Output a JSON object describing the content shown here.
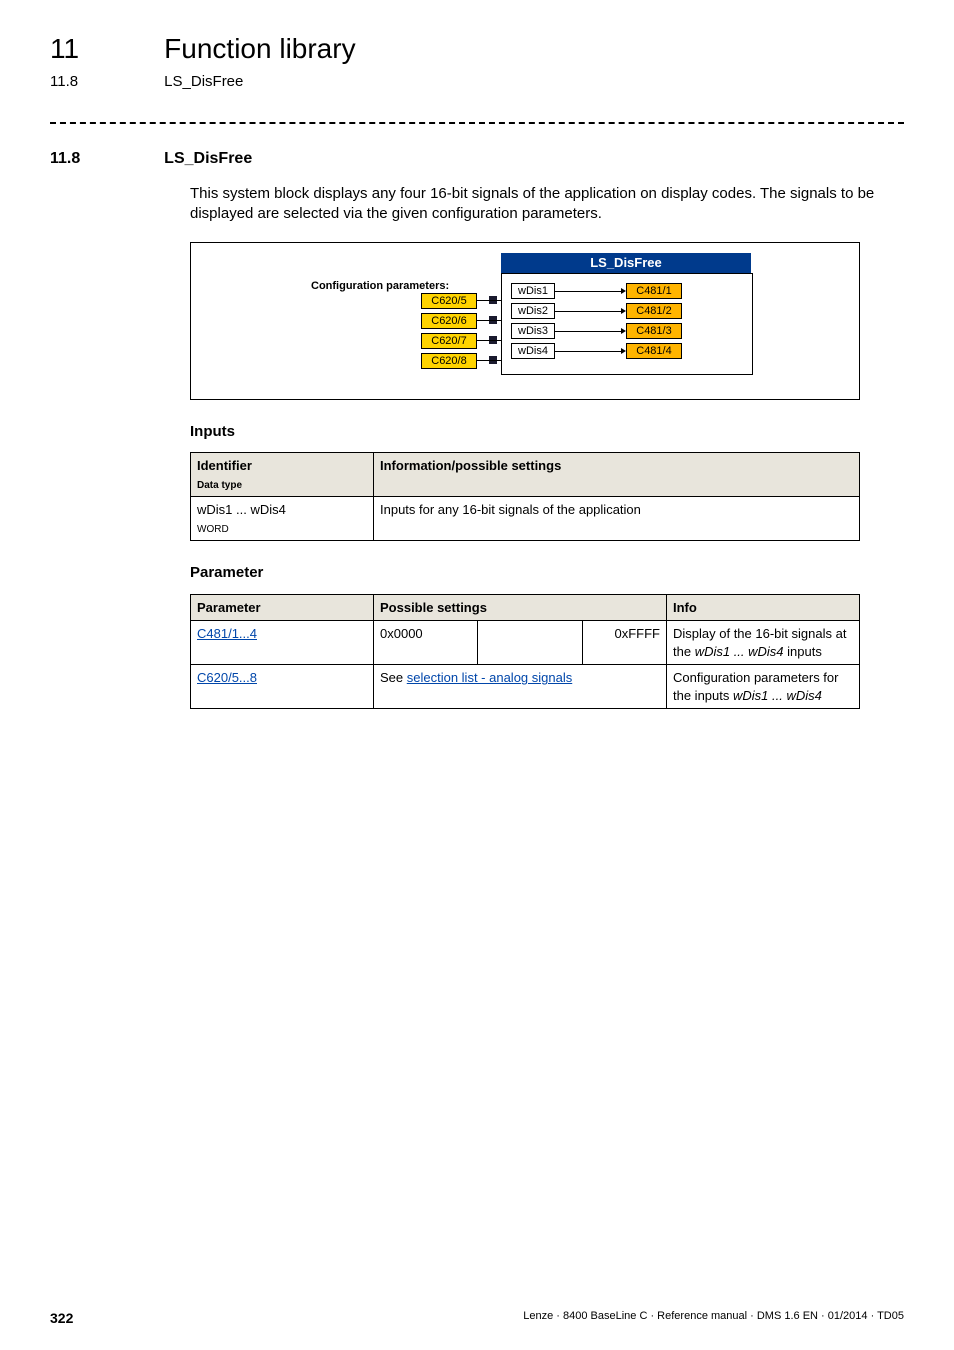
{
  "header": {
    "chapter_number": "11",
    "chapter_title": "Function library",
    "section_number": "11.8",
    "section_name": "LS_DisFree"
  },
  "section": {
    "num": "11.8",
    "title": "LS_DisFree",
    "intro": "This system block displays any four 16-bit signals of the application on display codes. The signals to be displayed are selected via the given configuration parameters."
  },
  "diagram": {
    "titlebar": "LS_DisFree",
    "conf_label": "Configuration parameters:",
    "yellow": [
      "C620/5",
      "C620/6",
      "C620/7",
      "C620/8"
    ],
    "wlabels": [
      "wDis1",
      "wDis2",
      "wDis3",
      "wDis4"
    ],
    "orange": [
      "C481/1",
      "C481/2",
      "C481/3",
      "C481/4"
    ]
  },
  "inputs_heading": "Inputs",
  "inputs_table": {
    "head_identifier": "Identifier",
    "head_datatype": "Data type",
    "head_info": "Information/possible settings",
    "row1_id": "wDis1 ... wDis4",
    "row1_type": "WORD",
    "row1_desc": "Inputs for any 16-bit signals of the application"
  },
  "param_heading": "Parameter",
  "param_table": {
    "head_param": "Parameter",
    "head_settings": "Possible settings",
    "head_info": "Info",
    "r1_param": "C481/1...4",
    "r1_min": "0x0000",
    "r1_max": "0xFFFF",
    "r1_info_a": "Display of the 16-bit signals at the ",
    "r1_info_b": "wDis1 ... wDis4",
    "r1_info_c": " inputs",
    "r2_param": "C620/5...8",
    "r2_settings_a": "See ",
    "r2_settings_b": "selection list - analog signals",
    "r2_info_a": "Configuration parameters for the inputs ",
    "r2_info_b": "wDis1 ... wDis4"
  },
  "footer": {
    "page": "322",
    "meta": "Lenze · 8400 BaseLine C · Reference manual · DMS 1.6 EN · 01/2014 · TD05"
  }
}
